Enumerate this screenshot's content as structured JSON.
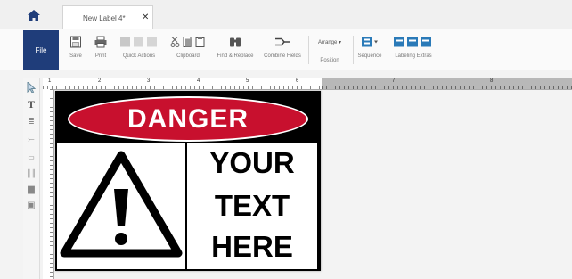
{
  "tabs": {
    "active_label": "New Label 4*"
  },
  "ribbon": {
    "file": "File",
    "save": "Save",
    "print": "Print",
    "quick_actions": "Quick Actions",
    "clipboard": "Clipboard",
    "find_replace": "Find & Replace",
    "combine_fields": "Combine Fields",
    "arrange": "Arrange ▾",
    "position": "Position",
    "sequence": "Sequence",
    "labeling_extras": "Labeling Extras"
  },
  "ruler": {
    "marks": [
      "1",
      "2",
      "3",
      "4",
      "5",
      "6",
      "7",
      "8"
    ]
  },
  "label": {
    "header": "DANGER",
    "line1": "YOUR",
    "line2": "TEXT",
    "line3": "HERE",
    "danger_color": "#c8102e"
  }
}
